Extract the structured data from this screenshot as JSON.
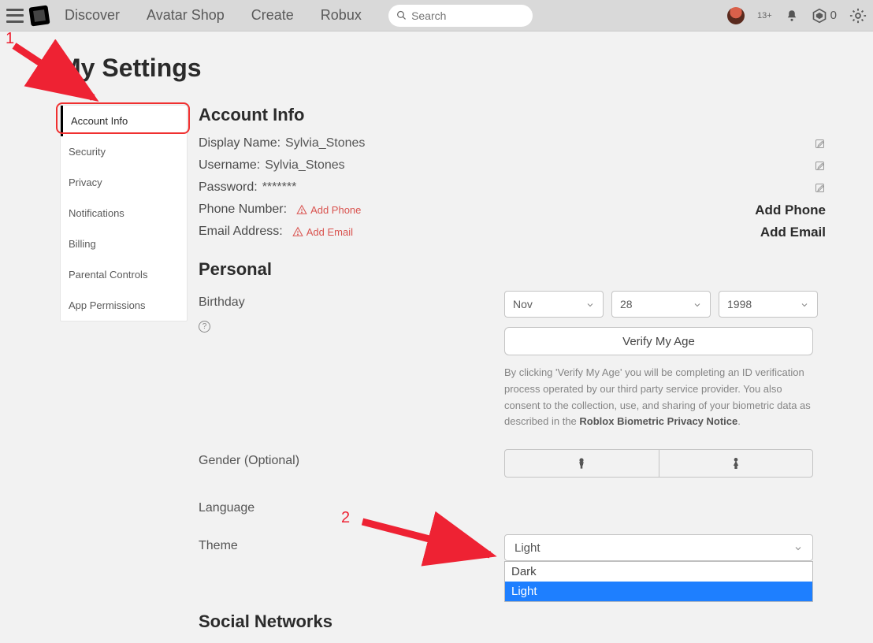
{
  "topnav": {
    "links": [
      "Discover",
      "Avatar Shop",
      "Create",
      "Robux"
    ],
    "search_placeholder": "Search",
    "age_badge": "13+",
    "robux_count": "0"
  },
  "page_title": "My Settings",
  "sidebar": {
    "items": [
      {
        "label": "Account Info",
        "active": true
      },
      {
        "label": "Security"
      },
      {
        "label": "Privacy"
      },
      {
        "label": "Notifications"
      },
      {
        "label": "Billing"
      },
      {
        "label": "Parental Controls"
      },
      {
        "label": "App Permissions"
      }
    ]
  },
  "account_info": {
    "heading": "Account Info",
    "display_name_label": "Display Name:",
    "display_name_value": "Sylvia_Stones",
    "username_label": "Username:",
    "username_value": "Sylvia_Stones",
    "password_label": "Password:",
    "password_value": "*******",
    "phone_label": "Phone Number:",
    "phone_warn": "Add Phone",
    "phone_action": "Add Phone",
    "email_label": "Email Address:",
    "email_warn": "Add Email",
    "email_action": "Add Email"
  },
  "personal": {
    "heading": "Personal",
    "birthday_label": "Birthday",
    "birthday": {
      "month": "Nov",
      "day": "28",
      "year": "1998"
    },
    "verify_button": "Verify My Age",
    "disclaimer_part1": "By clicking 'Verify My Age' you will be completing an ID verification process operated by our third party service provider. You also consent to the collection, use, and sharing of your biometric data as described in the ",
    "disclaimer_link": "Roblox Biometric Privacy Notice",
    "disclaimer_part2": ".",
    "gender_label": "Gender (Optional)",
    "language_label": "Language",
    "theme_label": "Theme",
    "theme_value": "Light",
    "theme_options": [
      "Dark",
      "Light"
    ]
  },
  "social": {
    "heading": "Social Networks"
  },
  "annotations": {
    "one": "1",
    "two": "2"
  }
}
